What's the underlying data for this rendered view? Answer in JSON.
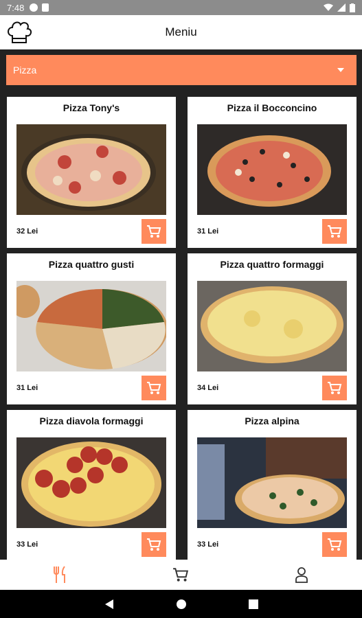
{
  "status_bar": {
    "time": "7:48"
  },
  "header": {
    "title": "Meniu",
    "logo_icon": "chef-hat-icon"
  },
  "category_select": {
    "selected": "Pizza"
  },
  "products": [
    {
      "name": "Pizza Tony's",
      "price": "32 Lei",
      "photo": "pizza-photo"
    },
    {
      "name": "Pizza il Bocconcino",
      "price": "31 Lei",
      "photo": "pizza-photo"
    },
    {
      "name": "Pizza quattro gusti",
      "price": "31 Lei",
      "photo": "pizza-photo"
    },
    {
      "name": "Pizza quattro formaggi",
      "price": "34 Lei",
      "photo": "pizza-photo"
    },
    {
      "name": "Pizza diavola formaggi",
      "price": "33 Lei",
      "photo": "pizza-photo"
    },
    {
      "name": "Pizza alpina",
      "price": "33 Lei",
      "photo": "pizza-photo"
    }
  ],
  "bottom_nav": [
    {
      "icon": "fork-knife-icon",
      "active": true
    },
    {
      "icon": "cart-icon",
      "active": false
    },
    {
      "icon": "user-icon",
      "active": false
    }
  ],
  "colors": {
    "accent": "#ff8a5c",
    "background": "#222222"
  }
}
